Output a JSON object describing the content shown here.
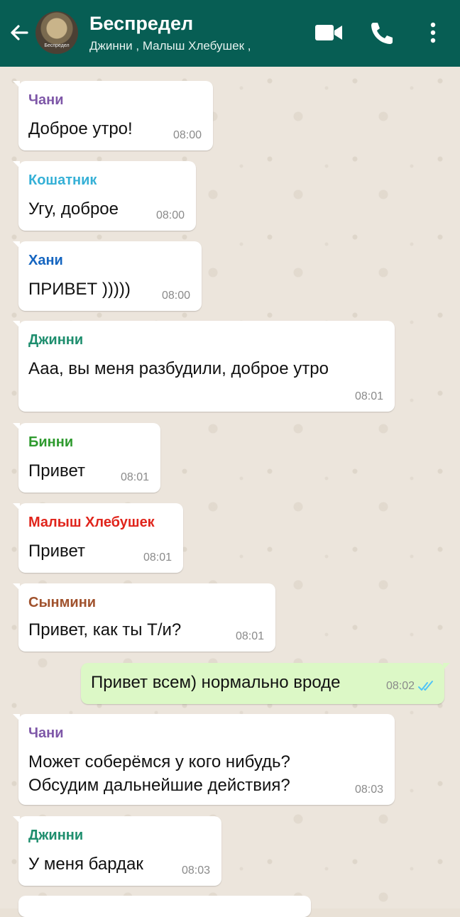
{
  "header": {
    "title": "Беспредел",
    "subtitle": "Джинни , Малыш Хлебушек ,",
    "avatar_text": "Беспредел",
    "back_icon": "arrow-left-icon",
    "video_icon": "videocam-icon",
    "call_icon": "phone-icon",
    "menu_icon": "more-vert-icon",
    "bg_color": "#075e54"
  },
  "messages": [
    {
      "sender": "Чани",
      "sender_color": "#7e57a8",
      "text": "Доброе утро!",
      "time": "08:00"
    },
    {
      "sender": "Кошатник",
      "sender_color": "#35b0d6",
      "text": "Угу, доброе",
      "time": "08:00"
    },
    {
      "sender": "Хани",
      "sender_color": "#1565c0",
      "text": "ПРИВЕТ )))))",
      "time": "08:00"
    },
    {
      "sender": "Джинни",
      "sender_color": "#1e8e6e",
      "text": "Ааа, вы меня разбудили,  доброе утро",
      "time": "08:01"
    },
    {
      "sender": "Бинни",
      "sender_color": "#2e9a2e",
      "text": "Привет",
      "time": "08:01"
    },
    {
      "sender": "Малыш Хлебушек",
      "sender_color": "#e0241b",
      "text": "Привет",
      "time": "08:01"
    },
    {
      "sender": "Сынмини",
      "sender_color": "#a0522d",
      "text": "Привет,  как ты Т/и?",
      "time": "08:01"
    },
    {
      "outgoing": true,
      "text": "Привет всем) нормально вроде",
      "time": "08:02",
      "status_icon": "double-check-icon",
      "status_color": "#4fc3f7"
    },
    {
      "sender": "Чани",
      "sender_color": "#7e57a8",
      "text_lines": [
        "Может соберёмся у кого нибудь?",
        "Обсудим дальнейшие действия?"
      ],
      "time": "08:03"
    },
    {
      "sender": "Джинни",
      "sender_color": "#1e8e6e",
      "text": "У меня бардак",
      "time": "08:03"
    }
  ]
}
